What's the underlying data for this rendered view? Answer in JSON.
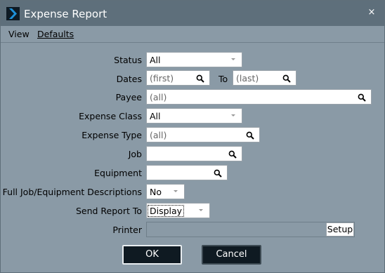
{
  "window": {
    "title": "Expense Report",
    "close_glyph": "×",
    "accent_color": "#1e90d8"
  },
  "menu": {
    "items": [
      {
        "label": "View"
      },
      {
        "label": "Defaults"
      }
    ]
  },
  "form": {
    "status": {
      "label": "Status",
      "value": "All"
    },
    "dates": {
      "label": "Dates",
      "first_placeholder": "(first)",
      "to_label": "To",
      "last_placeholder": "(last)"
    },
    "payee": {
      "label": "Payee",
      "placeholder": "(all)"
    },
    "expense_class": {
      "label": "Expense Class",
      "value": "All"
    },
    "expense_type": {
      "label": "Expense Type",
      "placeholder": "(all)"
    },
    "job": {
      "label": "Job",
      "value": ""
    },
    "equipment": {
      "label": "Equipment",
      "value": ""
    },
    "full_descriptions": {
      "label": "Full Job/Equipment Descriptions",
      "value": "No"
    },
    "send_report_to": {
      "label": "Send Report To",
      "value": "Display"
    },
    "printer": {
      "label": "Printer",
      "value": "",
      "setup_label": "Setup"
    }
  },
  "buttons": {
    "ok": "OK",
    "cancel": "Cancel"
  }
}
